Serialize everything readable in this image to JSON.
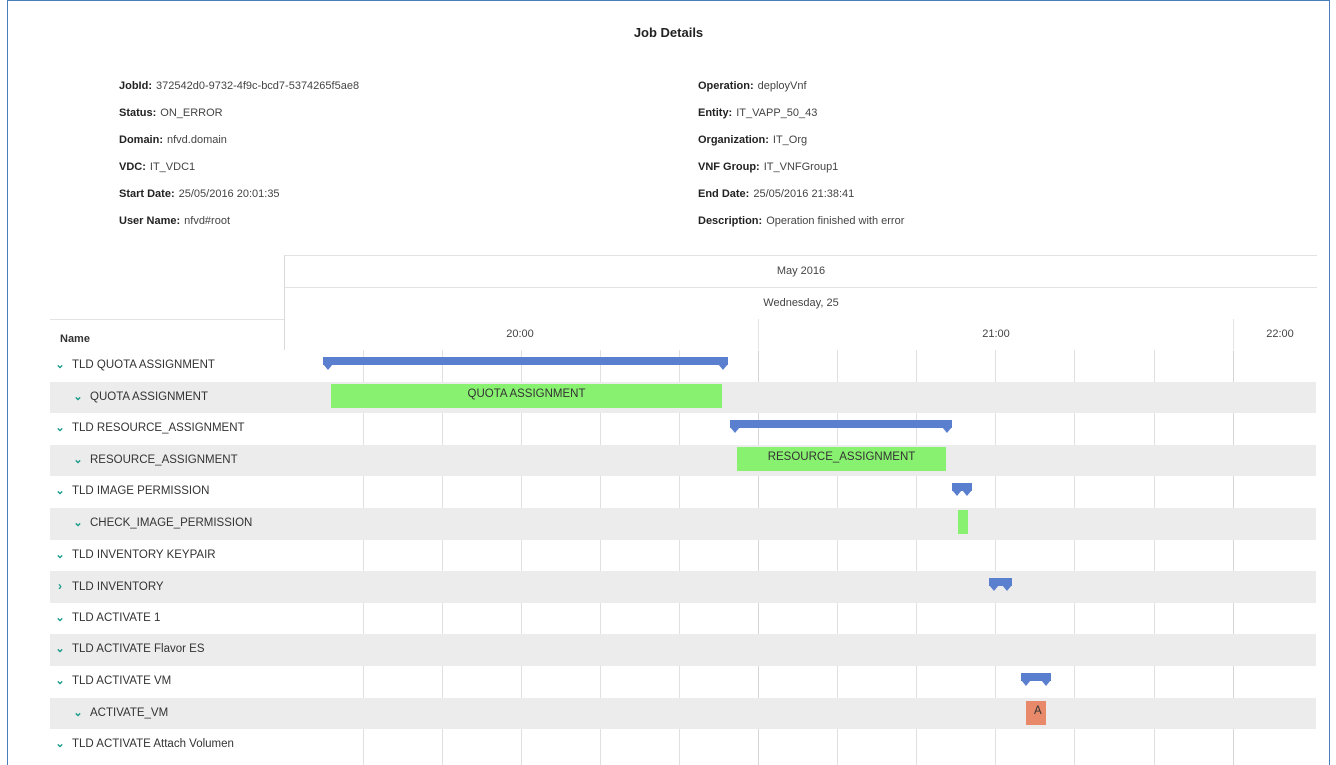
{
  "title": "Job Details",
  "details_left": [
    {
      "label": "JobId:",
      "value": "372542d0-9732-4f9c-bcd7-5374265f5ae8"
    },
    {
      "label": "Status:",
      "value": "ON_ERROR"
    },
    {
      "label": "Domain:",
      "value": "nfvd.domain"
    },
    {
      "label": "VDC:",
      "value": "IT_VDC1"
    },
    {
      "label": "Start Date:",
      "value": "25/05/2016 20:01:35"
    },
    {
      "label": "User Name:",
      "value": "nfvd#root"
    }
  ],
  "details_right": [
    {
      "label": "Operation:",
      "value": "deployVnf"
    },
    {
      "label": "Entity:",
      "value": "IT_VAPP_50_43"
    },
    {
      "label": "Organization:",
      "value": "IT_Org"
    },
    {
      "label": "VNF Group:",
      "value": "IT_VNFGroup1"
    },
    {
      "label": "End Date:",
      "value": "25/05/2016 21:38:41"
    },
    {
      "label": "Description:",
      "value": "Operation finished with error"
    }
  ],
  "gantt": {
    "month_label": "May 2016",
    "day_label": "Wednesday, 25",
    "name_header": "Name",
    "hours": [
      "20:00",
      "21:00",
      "22:00"
    ],
    "colors": {
      "summary": "#5b7fcf",
      "task": "#88f270",
      "error": "#e8896a",
      "chevron": "#1a9c8a"
    },
    "rows": [
      {
        "label": "TLD QUOTA ASSIGNMENT",
        "chevron": "expanded",
        "indent": 0
      },
      {
        "label": "QUOTA ASSIGNMENT",
        "chevron": "expanded",
        "indent": 1,
        "bar_label": "QUOTA ASSIGNMENT"
      },
      {
        "label": "TLD RESOURCE_ASSIGNMENT",
        "chevron": "expanded",
        "indent": 0
      },
      {
        "label": "RESOURCE_ASSIGNMENT",
        "chevron": "expanded",
        "indent": 1,
        "bar_label": "RESOURCE_ASSIGNMENT"
      },
      {
        "label": "TLD IMAGE PERMISSION",
        "chevron": "expanded",
        "indent": 0
      },
      {
        "label": "CHECK_IMAGE_PERMISSION",
        "chevron": "expanded",
        "indent": 1
      },
      {
        "label": "TLD INVENTORY KEYPAIR",
        "chevron": "expanded",
        "indent": 0
      },
      {
        "label": "TLD INVENTORY",
        "chevron": "collapsed",
        "indent": 0
      },
      {
        "label": "TLD ACTIVATE 1",
        "chevron": "expanded",
        "indent": 0
      },
      {
        "label": "TLD ACTIVATE Flavor ES",
        "chevron": "expanded",
        "indent": 0
      },
      {
        "label": "TLD ACTIVATE VM",
        "chevron": "expanded",
        "indent": 0
      },
      {
        "label": "ACTIVATE_VM",
        "chevron": "expanded",
        "indent": 1,
        "bar_label": "A"
      },
      {
        "label": "TLD ACTIVATE Attach Volumen",
        "chevron": "expanded",
        "indent": 0
      }
    ]
  }
}
